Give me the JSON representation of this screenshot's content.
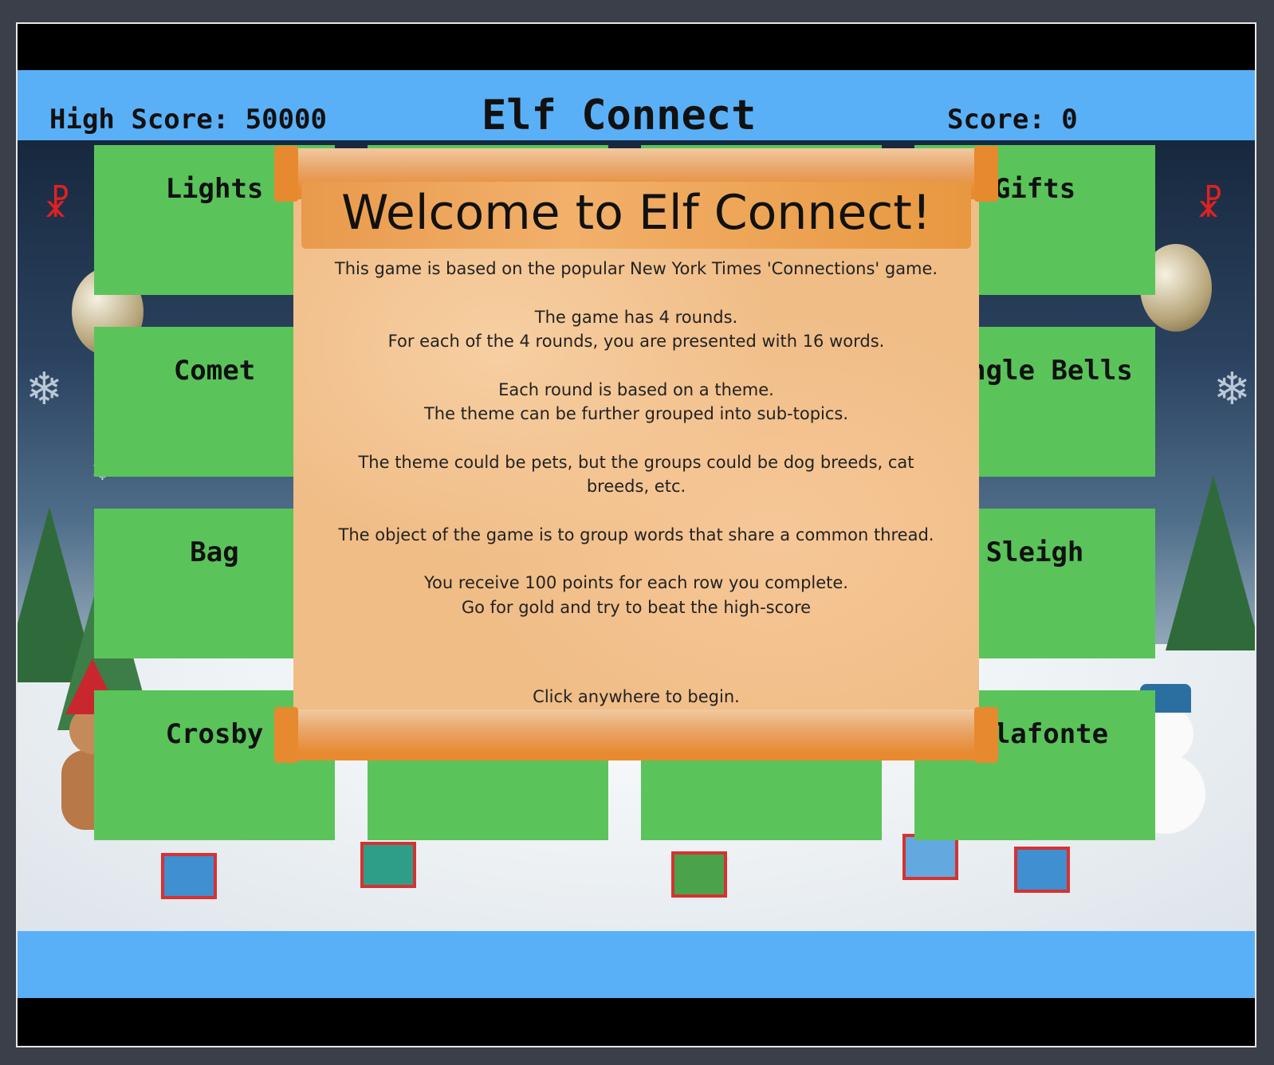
{
  "header": {
    "high_score": "High Score: 50000",
    "title": "Elf Connect",
    "score": "Score: 0"
  },
  "tiles": [
    "Lights",
    "",
    "",
    "Gifts",
    "Comet",
    "",
    "",
    "Jingle Bells",
    "Bag",
    "",
    "",
    "Sleigh",
    "Crosby",
    "",
    "",
    "Belafonte"
  ],
  "modal": {
    "title": "Welcome to Elf Connect!",
    "paragraphs": [
      "This game is based on the popular New York Times 'Connections' game.",
      "The game has 4 rounds.\nFor each of the 4 rounds, you are presented with 16 words.",
      "Each round is based on a theme.\nThe theme can be further grouped into sub-topics.",
      "The theme could be pets, but the groups could be dog breeds, cat breeds, etc.",
      "The object of the game is to group words that share a common thread.",
      "You receive 100 points for each row you complete.\nGo for gold and try to beat the high-score"
    ],
    "begin": "Click anywhere to begin."
  },
  "colors": {
    "header_bar": "#5ab0f7",
    "tile": "#5ac45a",
    "scroll": "#f0bd87",
    "scroll_rod": "#e78a30"
  }
}
